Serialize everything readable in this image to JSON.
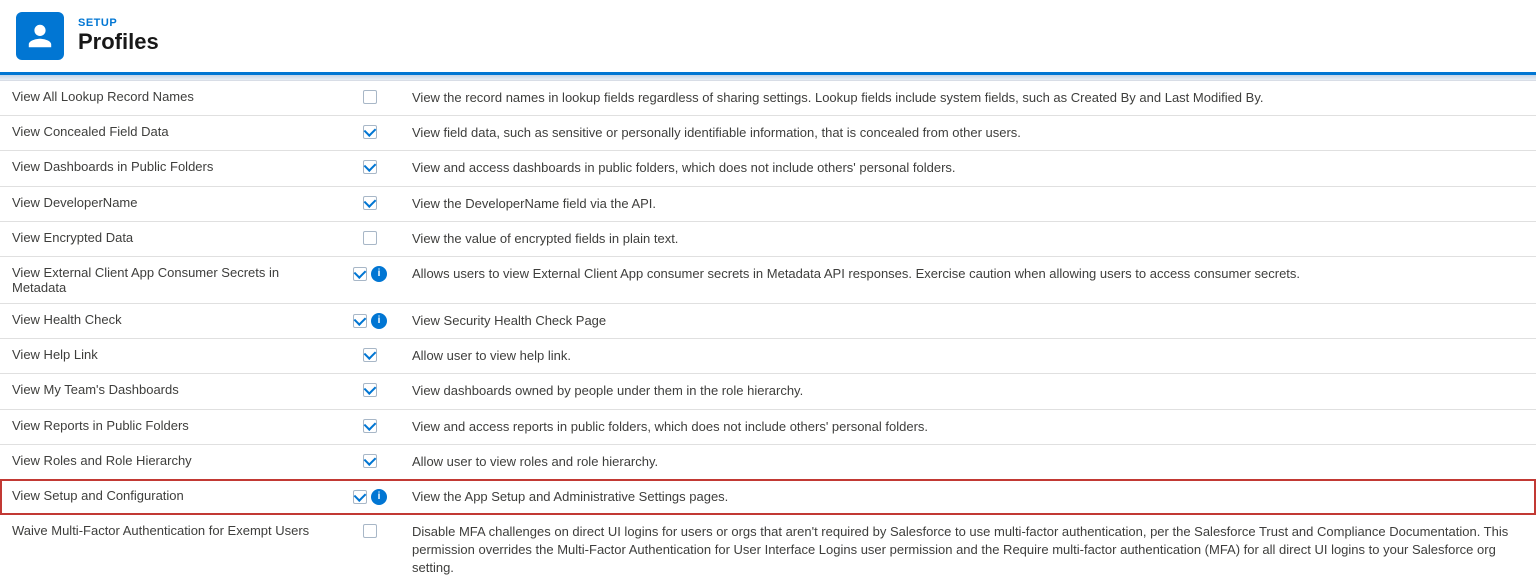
{
  "header": {
    "setup_label": "SETUP",
    "page_title": "Profiles"
  },
  "rows": [
    {
      "id": "view-all-lookup",
      "name": "View All Lookup Record Names",
      "checked": false,
      "has_info": false,
      "description": "View the record names in lookup fields regardless of sharing settings. Lookup fields include system fields, such as Created By and Last Modified By.",
      "highlighted": false
    },
    {
      "id": "view-concealed",
      "name": "View Concealed Field Data",
      "checked": true,
      "has_info": false,
      "description": "View field data, such as sensitive or personally identifiable information, that is concealed from other users.",
      "highlighted": false
    },
    {
      "id": "view-dashboards-public",
      "name": "View Dashboards in Public Folders",
      "checked": true,
      "has_info": false,
      "description": "View and access dashboards in public folders, which does not include others' personal folders.",
      "highlighted": false
    },
    {
      "id": "view-developer-name",
      "name": "View DeveloperName",
      "checked": true,
      "has_info": false,
      "description": "View the DeveloperName field via the API.",
      "highlighted": false
    },
    {
      "id": "view-encrypted",
      "name": "View Encrypted Data",
      "checked": false,
      "has_info": false,
      "description": "View the value of encrypted fields in plain text.",
      "highlighted": false
    },
    {
      "id": "view-external-client",
      "name": "View External Client App Consumer Secrets in Metadata",
      "checked": true,
      "has_info": true,
      "description": "Allows users to view External Client App consumer secrets in Metadata API responses. Exercise caution when allowing users to access consumer secrets.",
      "highlighted": false
    },
    {
      "id": "view-health-check",
      "name": "View Health Check",
      "checked": true,
      "has_info": true,
      "description": "View Security Health Check Page",
      "highlighted": false
    },
    {
      "id": "view-help-link",
      "name": "View Help Link",
      "checked": true,
      "has_info": false,
      "description": "Allow user to view help link.",
      "highlighted": false
    },
    {
      "id": "view-my-teams-dashboards",
      "name": "View My Team's Dashboards",
      "checked": true,
      "has_info": false,
      "description": "View dashboards owned by people under them in the role hierarchy.",
      "highlighted": false
    },
    {
      "id": "view-reports-public",
      "name": "View Reports in Public Folders",
      "checked": true,
      "has_info": false,
      "description": "View and access reports in public folders, which does not include others' personal folders.",
      "highlighted": false
    },
    {
      "id": "view-roles",
      "name": "View Roles and Role Hierarchy",
      "checked": true,
      "has_info": false,
      "description": "Allow user to view roles and role hierarchy.",
      "highlighted": false
    },
    {
      "id": "view-setup",
      "name": "View Setup and Configuration",
      "checked": true,
      "has_info": true,
      "description": "View the App Setup and Administrative Settings pages.",
      "highlighted": true
    },
    {
      "id": "waive-mfa",
      "name": "Waive Multi-Factor Authentication for Exempt Users",
      "checked": false,
      "has_info": false,
      "description": "Disable MFA challenges on direct UI logins for users or orgs that aren't required by Salesforce to use multi-factor authentication, per the Salesforce Trust and Compliance Documentation. This permission overrides the Multi-Factor Authentication for User Interface Logins user permission and the Require multi-factor authentication (MFA) for all direct UI logins to your Salesforce org setting.",
      "highlighted": false
    }
  ]
}
